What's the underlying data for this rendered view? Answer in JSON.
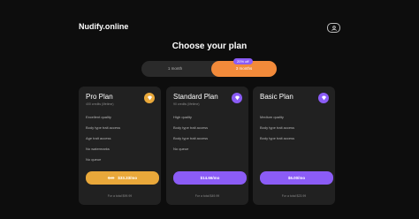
{
  "header": {
    "logo": "Nudify.online",
    "user_icon": "user-circle-icon"
  },
  "page": {
    "title": "Choose your plan"
  },
  "billing_toggle": {
    "options": [
      {
        "label": "1 month",
        "selected": false
      },
      {
        "label": "3 months",
        "selected": true
      }
    ],
    "discount_badge": "20% off"
  },
  "plans": [
    {
      "name": "Pro Plan",
      "credits": "400 credits (lifetime)",
      "icon": "diamond-icon",
      "icon_color": "#e9a83a",
      "features": [
        "Excellent quality",
        "Body type trait access",
        "Age trait access",
        "No watermarks",
        "No queue"
      ],
      "old_price": "$49",
      "price": "$33.33/mo",
      "button_color": "#e9a83a",
      "total": "For a total $99.99"
    },
    {
      "name": "Standard Plan",
      "credits": "90 credits (lifetime)",
      "icon": "diamond-icon",
      "icon_color": "#8b5cf6",
      "features": [
        "High quality",
        "Body type trait access",
        "Body type trait access",
        "No queue"
      ],
      "price": "$14.66/mo",
      "button_color": "#8b5cf6",
      "total": "For a total $49.99"
    },
    {
      "name": "Basic Plan",
      "credits": "",
      "icon": "diamond-icon",
      "icon_color": "#8b5cf6",
      "features": [
        "Medium quality",
        "Body type trait access",
        "Body type trait access"
      ],
      "price": "$6.00/mo",
      "button_color": "#8b5cf6",
      "total": "For a total $23.99"
    }
  ]
}
